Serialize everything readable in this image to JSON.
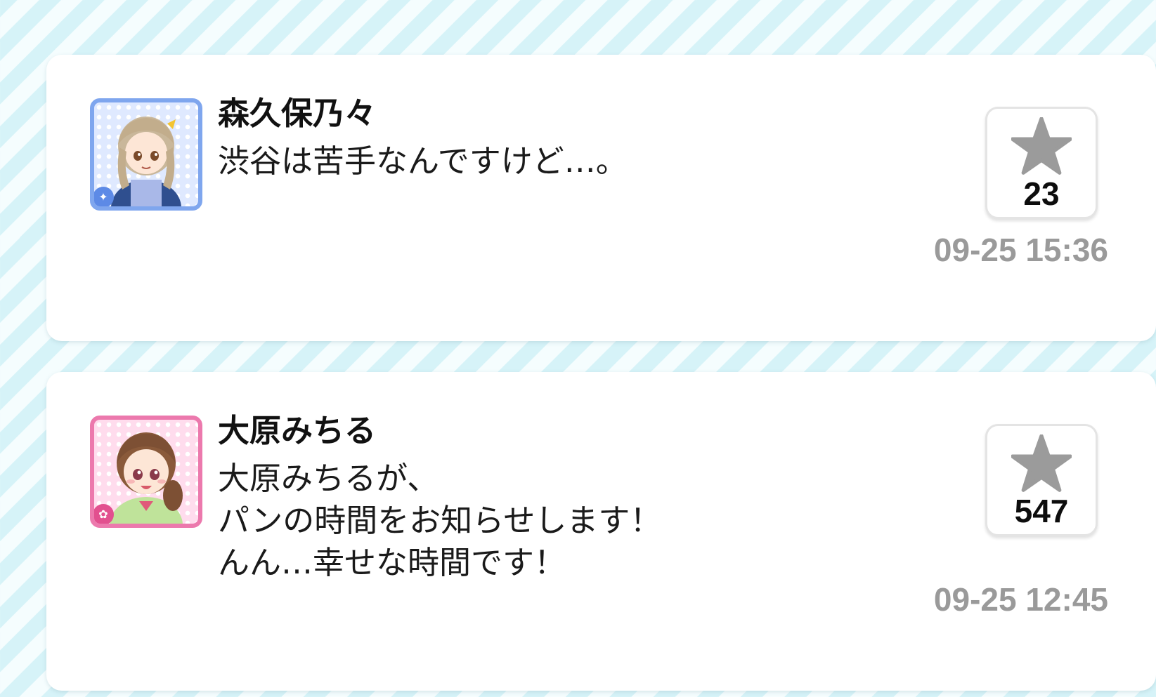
{
  "posts": [
    {
      "name": "森久保乃々",
      "message": "渋谷は苦手なんですけど…。",
      "likes": "23",
      "timestamp": "09-25 15:36",
      "avatar_theme": "#7fa6ee",
      "avatar_icon": "character-portrait",
      "type_icon": "cool-type-icon"
    },
    {
      "name": "大原みちる",
      "message": "大原みちるが、\nパンの時間をお知らせします！\nんん…幸せな時間です！",
      "likes": "547",
      "timestamp": "09-25 12:45",
      "avatar_theme": "#ec79ad",
      "avatar_icon": "character-portrait",
      "type_icon": "cute-type-icon"
    }
  ],
  "like_icon": "star-icon",
  "like_icon_color": "#9b9b9b",
  "timestamp_color": "#9a9a9a"
}
